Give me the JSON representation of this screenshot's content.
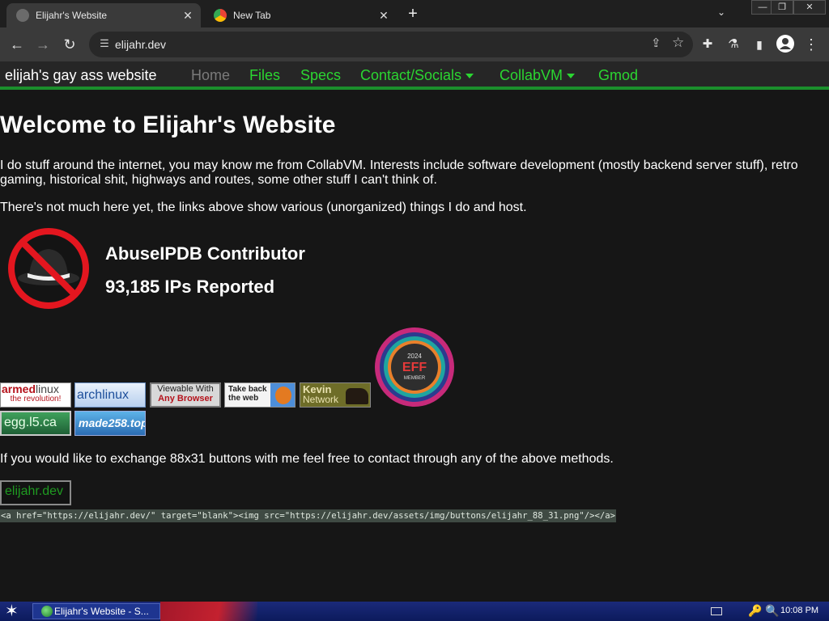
{
  "browser": {
    "tabs": [
      {
        "title": "Elijahr's Website",
        "close": "✕"
      },
      {
        "title": "New Tab",
        "close": "✕"
      }
    ],
    "new_tab": "+",
    "tab_menu": "⌄",
    "window_controls": [
      "—",
      "❐",
      "✕"
    ],
    "url": "elijahr.dev",
    "toolbar_icons": {
      "back": "←",
      "forward": "→",
      "reload": "↻",
      "share": "⇪",
      "bookmark": "☆",
      "extensions": "✚",
      "labs": "⚗",
      "side_panel": "▮",
      "profile": "●",
      "menu": "⋮"
    }
  },
  "site": {
    "brand": "elijah's gay ass website",
    "nav": [
      "Home",
      "Files",
      "Specs",
      "Contact/Socials",
      "CollabVM",
      "Gmod"
    ],
    "heading": "Welcome to Elijahr's Website",
    "intro_line1": "I do stuff around the internet, you may know me from CollabVM. Interests include software development (mostly backend server stuff), retro",
    "intro_line2": "gaming, historical shit, highways and routes, some other stuff I can't think of.",
    "intro2": "There's not much here yet, the links above show various (unorganized) things I do and host.",
    "abuse_title": "AbuseIPDB Contributor",
    "abuse_count": "93,185 IPs Reported",
    "eff_badge": {
      "year": "2024",
      "name": "EFF",
      "label": "MEMBER"
    },
    "buttons": {
      "armed_top": "armedlinux",
      "armed_bottom": "the revolution!",
      "arch": "archlinux",
      "viewable_top": "Viewable With",
      "viewable_bottom": "Any Browser",
      "takeback_top": "Take back",
      "takeback_bottom": "the web",
      "kevin_top": "Kevin",
      "kevin_bottom": "Network",
      "egg": "egg.l5.ca",
      "made": "made258.top"
    },
    "exchange_text": "If you would like to exchange 88x31 buttons with me feel free to contact through any of the above methods.",
    "own_button": "elijahr.dev",
    "code_snippet": "<a href=\"https://elijahr.dev/\" target=\"blank\"><img src=\"https://elijahr.dev/assets/img/buttons/elijahr_88_31.png\"/></a>"
  },
  "taskbar": {
    "start": "✶",
    "task_title": "Elijahr's Website - S...",
    "tray": "🔑 🔍",
    "clock": "10:08 PM"
  },
  "colors": {
    "accent": "#2bd631",
    "nav_border": "#1b8f2c",
    "page_bg": "#161616"
  }
}
